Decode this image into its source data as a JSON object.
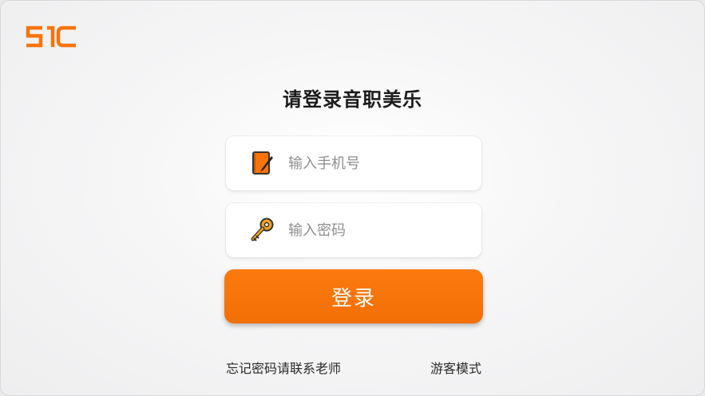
{
  "app": {
    "logo_text": "SIC",
    "brand_color": "#F7740A"
  },
  "login": {
    "title": "请登录音职美乐",
    "phone_placeholder": "输入手机号",
    "password_placeholder": "输入密码",
    "login_button_label": "登录",
    "phone_icon": "notebook-pen-icon",
    "password_icon": "key-icon"
  },
  "footer": {
    "forgot_password_label": "忘记密码请联系老师",
    "guest_mode_label": "游客模式"
  }
}
